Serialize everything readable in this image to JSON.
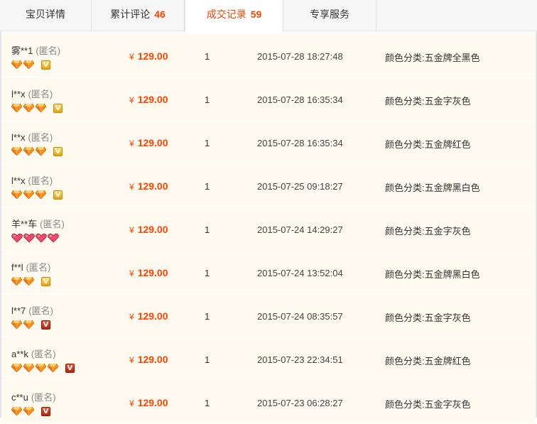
{
  "tabs": [
    {
      "label": "宝贝详情",
      "count": ""
    },
    {
      "label": "累计评论",
      "count": "46"
    },
    {
      "label": "成交记录",
      "count": "59"
    },
    {
      "label": "专享服务",
      "count": ""
    }
  ],
  "active_tab": 2,
  "colors": {
    "accent": "#ff4400",
    "row_bg": "#fffaef"
  },
  "records": [
    {
      "buyer": "雾**1",
      "anon": "(匿名)",
      "badge": {
        "type": "gem",
        "count": 2
      },
      "vip": "gold",
      "price_symbol": "¥",
      "price": "129.00",
      "qty": "1",
      "date": "2015-07-28 18:27:48",
      "variant": "颜色分类:五金牌全黑色"
    },
    {
      "buyer": "l**x",
      "anon": "(匿名)",
      "badge": {
        "type": "gem",
        "count": 3
      },
      "vip": "gold",
      "price_symbol": "¥",
      "price": "129.00",
      "qty": "1",
      "date": "2015-07-28 16:35:34",
      "variant": "颜色分类:五金字灰色"
    },
    {
      "buyer": "l**x",
      "anon": "(匿名)",
      "badge": {
        "type": "gem",
        "count": 3
      },
      "vip": "gold",
      "price_symbol": "¥",
      "price": "129.00",
      "qty": "1",
      "date": "2015-07-28 16:35:34",
      "variant": "颜色分类:五金牌红色"
    },
    {
      "buyer": "l**x",
      "anon": "(匿名)",
      "badge": {
        "type": "gem",
        "count": 3
      },
      "vip": "gold",
      "price_symbol": "¥",
      "price": "129.00",
      "qty": "1",
      "date": "2015-07-25 09:18:27",
      "variant": "颜色分类:五金牌黑白色"
    },
    {
      "buyer": "羊**车",
      "anon": "(匿名)",
      "badge": {
        "type": "heart",
        "count": 4
      },
      "vip": "",
      "price_symbol": "¥",
      "price": "129.00",
      "qty": "1",
      "date": "2015-07-24 14:29:27",
      "variant": "颜色分类:五金字灰色"
    },
    {
      "buyer": "f**l",
      "anon": "(匿名)",
      "badge": {
        "type": "gem",
        "count": 2
      },
      "vip": "gold",
      "price_symbol": "¥",
      "price": "129.00",
      "qty": "1",
      "date": "2015-07-24 13:52:04",
      "variant": "颜色分类:五金牌黑白色"
    },
    {
      "buyer": "l**7",
      "anon": "(匿名)",
      "badge": {
        "type": "gem",
        "count": 2
      },
      "vip": "red",
      "price_symbol": "¥",
      "price": "129.00",
      "qty": "1",
      "date": "2015-07-24 08:35:57",
      "variant": "颜色分类:五金字灰色"
    },
    {
      "buyer": "a**k",
      "anon": "(匿名)",
      "badge": {
        "type": "gem",
        "count": 4
      },
      "vip": "red",
      "price_symbol": "¥",
      "price": "129.00",
      "qty": "1",
      "date": "2015-07-23 22:34:51",
      "variant": "颜色分类:五金牌红色"
    },
    {
      "buyer": "c**u",
      "anon": "(匿名)",
      "badge": {
        "type": "gem",
        "count": 2
      },
      "vip": "red",
      "price_symbol": "¥",
      "price": "129.00",
      "qty": "1",
      "date": "2015-07-23 06:28:27",
      "variant": "颜色分类:五金字灰色"
    }
  ]
}
